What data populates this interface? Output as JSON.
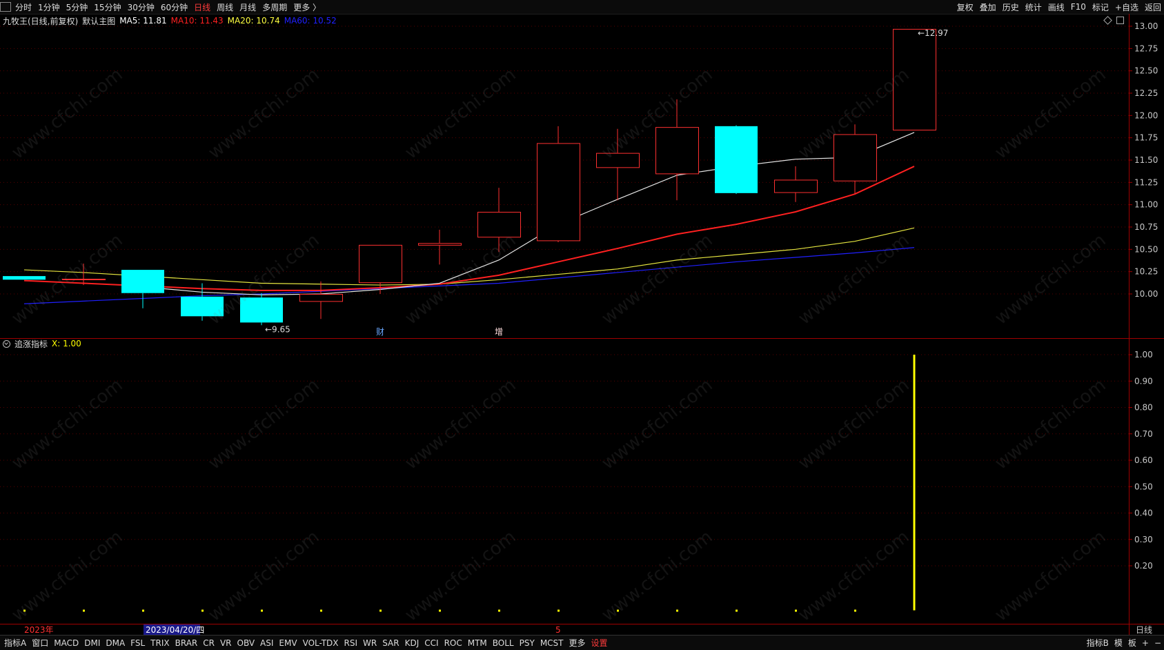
{
  "toolbar": {
    "periods": [
      "分时",
      "1分钟",
      "5分钟",
      "15分钟",
      "30分钟",
      "60分钟",
      "日线",
      "周线",
      "月线",
      "多周期",
      "更多 〉"
    ],
    "active_period": "日线",
    "right_items": [
      "复权",
      "叠加",
      "历史",
      "统计",
      "画线",
      "F10",
      "标记",
      "+自选",
      "返回"
    ]
  },
  "main_legend": {
    "stock_name": "九牧王(日线,前复权)",
    "template": "默认主图",
    "ma": [
      {
        "label": "MA5: 11.81",
        "color": "#ffffff"
      },
      {
        "label": "MA10: 11.43",
        "color": "#ff2020"
      },
      {
        "label": "MA20: 10.74",
        "color": "#ffff40"
      },
      {
        "label": "MA60: 10.52",
        "color": "#2020ff"
      }
    ]
  },
  "sub_legend": {
    "name": "追涨指标",
    "value": "X: 1.00",
    "value_color": "#ffff00"
  },
  "chart_data": {
    "type": "candlestick",
    "price_axis": {
      "ticks": [
        "13.00",
        "12.75",
        "12.50",
        "12.25",
        "12.00",
        "11.75",
        "11.50",
        "11.25",
        "11.00",
        "10.75",
        "10.50",
        "10.25",
        "10.00"
      ],
      "range": [
        9.5,
        13.05
      ]
    },
    "indicator_axis": {
      "ticks": [
        "1.00",
        "0.90",
        "0.80",
        "0.70",
        "0.60",
        "0.50",
        "0.40",
        "0.30",
        "0.20"
      ],
      "range": [
        0,
        1.02
      ]
    },
    "candles": [
      {
        "o": 10.2,
        "h": 10.2,
        "l": 10.16,
        "c": 10.16
      },
      {
        "o": 10.17,
        "h": 10.34,
        "l": 10.1,
        "c": 10.17
      },
      {
        "o": 10.27,
        "h": 10.27,
        "l": 9.84,
        "c": 10.01
      },
      {
        "o": 9.97,
        "h": 10.12,
        "l": 9.7,
        "c": 9.75
      },
      {
        "o": 9.96,
        "h": 10.01,
        "l": 9.65,
        "c": 9.68
      },
      {
        "o": 9.92,
        "h": 10.14,
        "l": 9.72,
        "c": 10.0
      },
      {
        "o": 10.13,
        "h": 10.13,
        "l": 10.0,
        "c": 10.55
      },
      {
        "o": 10.55,
        "h": 10.72,
        "l": 10.33,
        "c": 10.57
      },
      {
        "o": 10.64,
        "h": 11.19,
        "l": 10.47,
        "c": 10.92
      },
      {
        "o": 10.6,
        "h": 11.88,
        "l": 10.58,
        "c": 11.69
      },
      {
        "o": 11.42,
        "h": 11.85,
        "l": 11.05,
        "c": 11.58
      },
      {
        "o": 11.35,
        "h": 12.18,
        "l": 11.05,
        "c": 11.87
      },
      {
        "o": 11.88,
        "h": 11.89,
        "l": 11.12,
        "c": 11.13
      },
      {
        "o": 11.14,
        "h": 11.43,
        "l": 11.03,
        "c": 11.28
      },
      {
        "o": 11.27,
        "h": 11.9,
        "l": 11.12,
        "c": 11.79
      },
      {
        "o": 11.84,
        "h": 12.97,
        "l": 11.84,
        "c": 12.97
      }
    ],
    "ma5": [
      null,
      null,
      10.08,
      10.02,
      9.99,
      10.0,
      10.05,
      10.12,
      10.38,
      10.78,
      11.06,
      11.33,
      11.43,
      11.51,
      11.53,
      11.81
    ],
    "ma10": [
      10.15,
      10.12,
      10.09,
      10.06,
      10.04,
      10.04,
      10.07,
      10.11,
      10.21,
      10.36,
      10.51,
      10.67,
      10.78,
      10.92,
      11.12,
      11.43
    ],
    "ma20": [
      10.27,
      10.24,
      10.2,
      10.16,
      10.12,
      10.11,
      10.1,
      10.11,
      10.16,
      10.22,
      10.28,
      10.38,
      10.44,
      10.5,
      10.59,
      10.74
    ],
    "ma60": [
      9.89,
      9.92,
      9.95,
      9.98,
      10.0,
      10.03,
      10.06,
      10.09,
      10.12,
      10.18,
      10.24,
      10.3,
      10.36,
      10.41,
      10.46,
      10.52
    ],
    "annotations": {
      "high": "12.97",
      "low": "9.65",
      "marker_cai": "财",
      "marker_zeng": "增"
    },
    "indicator_values": [
      0,
      0,
      0,
      0,
      0,
      0,
      0,
      0,
      0,
      0,
      0,
      0,
      0,
      0,
      0,
      1.0
    ],
    "x_labels": {
      "year": "2023年",
      "date": "2023/04/20/四",
      "month": "5"
    }
  },
  "colors": {
    "up": "#ff3030",
    "down": "#00ffff",
    "ma5": "#e6e6e6",
    "ma10": "#ff2020",
    "ma20": "#e6e640",
    "ma60": "#2020ff",
    "grid": "#5a0000",
    "border": "#a00000",
    "axis_text": "#c8c8c8",
    "indicator": "#ffff00"
  },
  "axis_right_label": "日线",
  "bottombar": {
    "indicators": [
      "指标A",
      "窗口",
      "MACD",
      "DMI",
      "DMA",
      "FSL",
      "TRIX",
      "BRAR",
      "CR",
      "VR",
      "OBV",
      "ASI",
      "EMV",
      "VOL-TDX",
      "RSI",
      "WR",
      "SAR",
      "KDJ",
      "CCI",
      "ROC",
      "MTM",
      "BOLL",
      "PSY",
      "MCST",
      "更多",
      "设置"
    ],
    "right_items": [
      "指标B",
      "模",
      "板",
      "+",
      "−"
    ]
  },
  "watermark": "www.cfchi.com"
}
